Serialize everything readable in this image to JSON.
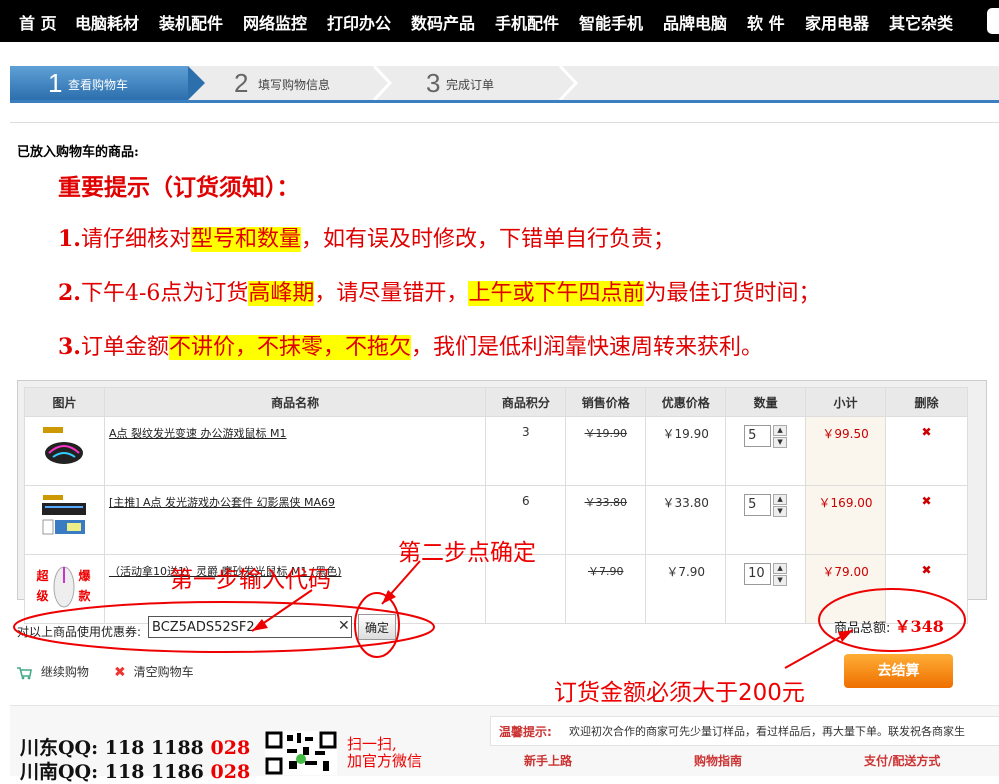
{
  "nav": [
    "首 页",
    "电脑耗材",
    "装机配件",
    "网络监控",
    "打印办公",
    "数码产品",
    "手机配件",
    "智能手机",
    "品牌电脑",
    "软 件",
    "家用电器",
    "其它杂类"
  ],
  "steps": [
    {
      "num": "1",
      "label": "查看购物车"
    },
    {
      "num": "2",
      "label": "填写购物信息"
    },
    {
      "num": "3",
      "label": "完成订单"
    }
  ],
  "cart_title": "已放入购物车的商品:",
  "notice": {
    "title": "重要提示（订货须知）：",
    "line1": {
      "n": "1.",
      "a": "请仔细核对",
      "h1": "型号和数量",
      "b": "，如有误及时修改，下错单自行负责；"
    },
    "line2": {
      "n": "2.",
      "a": "下午4-6点为订货",
      "h1": "高峰期",
      "b": "，请尽量错开，",
      "h2": "上午或下午四点前",
      "c": "为最佳订货时间；"
    },
    "line3": {
      "n": "3.",
      "a": "订单金额",
      "h1": "不讲价，不抹零，不拖欠",
      "b": "，我们是低利润靠快速周转来获利。"
    }
  },
  "table": {
    "headers": [
      "图片",
      "商品名称",
      "商品积分",
      "销售价格",
      "优惠价格",
      "数量",
      "小计",
      "删除"
    ],
    "rows": [
      {
        "name": "A点 裂纹发光变速 办公游戏鼠标 M1",
        "points": "3",
        "orig": "￥19.90",
        "price": "￥19.90",
        "qty": "5",
        "subtotal": "￥99.50",
        "del": "✖"
      },
      {
        "name": "[主推] A点 发光游戏办公套件 幻影黑侠 MA69",
        "points": "6",
        "orig": "￥33.80",
        "price": "￥33.80",
        "qty": "5",
        "subtotal": "￥169.00",
        "del": "✖"
      },
      {
        "name": "（活动拿10送1）灵爵 磨砂发光鼠标 M1 (黑色)",
        "points": "",
        "orig": "￥7.90",
        "price": "￥7.90",
        "qty": "10",
        "subtotal": "￥79.00",
        "del": "✖"
      }
    ],
    "promo_badge": {
      "a": "超",
      "b": "爆",
      "c": "级",
      "d": "款"
    }
  },
  "coupon": {
    "label": "对以上商品使用优惠券:",
    "value": "BCZ5ADS52SF2",
    "clear": "✕",
    "confirm": "确定"
  },
  "total": {
    "label": "商品总额:",
    "value": "￥348"
  },
  "actions": {
    "continue": "继续购物",
    "clear": "清空购物车",
    "checkout": "去结算"
  },
  "annotations": {
    "step1": "第一步输入代码",
    "step2": "第二步点确定",
    "min": "订货金额必须大于200元"
  },
  "footer": {
    "qq1": {
      "label": "川东QQ:",
      "num": "118 1188 ",
      "red": "028"
    },
    "qq2": {
      "label": "川南QQ:",
      "num": "118 1186 ",
      "red": "028"
    },
    "wx1": "扫一扫,",
    "wx2": "加官方微信",
    "tip_title": "温馨提示:",
    "tip_text": "欢迎初次合作的商家可先少量订样品，看过样品后，再大量下单。联发祝各商家生",
    "links": [
      "新手上路",
      "购物指南",
      "支付/配送方式"
    ]
  },
  "colors": {
    "accent": "#2c6fad",
    "alert": "#e00000",
    "highlight": "#ffff00",
    "checkout": "#ee6f00"
  }
}
